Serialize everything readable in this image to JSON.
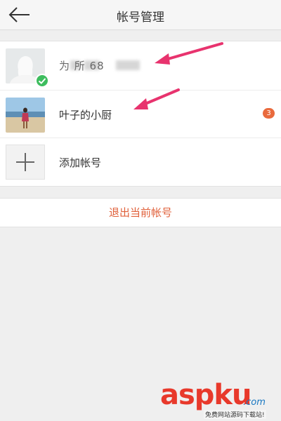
{
  "header": {
    "title": "帐号管理"
  },
  "accounts": [
    {
      "name": "为  所  68",
      "active": true,
      "badge": ""
    },
    {
      "name": "叶子的小厨",
      "active": false,
      "badge": "3"
    }
  ],
  "add_account_label": "添加帐号",
  "logout_label": "退出当前帐号",
  "icons": {
    "back": "back-arrow-icon",
    "check": "check-icon",
    "add": "plus-icon"
  },
  "colors": {
    "accent": "#e0603a",
    "badge": "#e96a3d",
    "check": "#3dbd5e",
    "annotation_arrow": "#e8336e"
  },
  "watermark": {
    "brand": "aspku",
    "domain": ".com",
    "subtitle": "免费网站源码下载站!"
  }
}
